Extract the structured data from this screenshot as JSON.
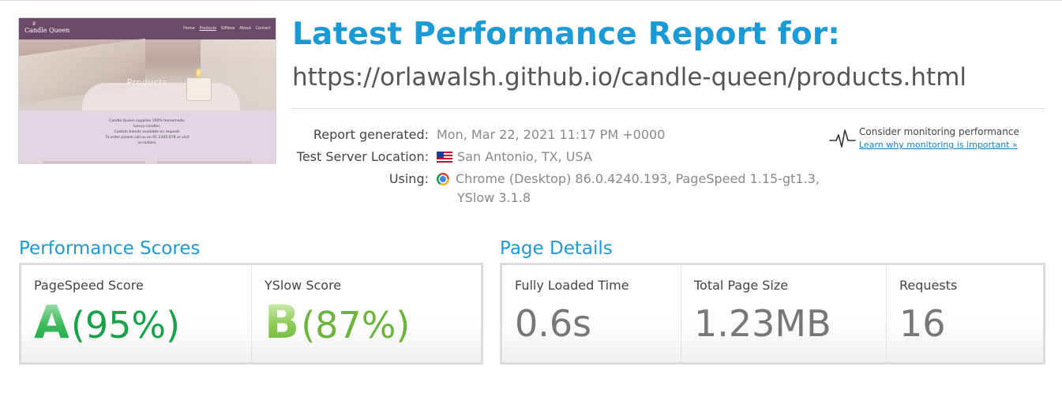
{
  "thumbnail": {
    "brand": "Candle Queen",
    "nav": [
      "Home",
      "Products",
      "Giftbox",
      "About",
      "Contact"
    ],
    "hero_title": "Products",
    "body_lines": [
      "Candle Queen supplies 100% homemade,",
      "luxury candles.",
      "Custom blends available on request.",
      "To order please call us on 01 2345 678 or visit",
      "us instore."
    ]
  },
  "header": {
    "title": "Latest Performance Report for:",
    "url": "https://orlawalsh.github.io/candle-queen/products.html"
  },
  "report": {
    "generated_label": "Report generated:",
    "generated_value": "Mon, Mar 22, 2021 11:17 PM +0000",
    "location_label": "Test Server Location:",
    "location_value": "San Antonio, TX, USA",
    "using_label": "Using:",
    "using_value_line1": "Chrome (Desktop) 86.0.4240.193, PageSpeed 1.15-gt1.3,",
    "using_value_line2": "YSlow 3.1.8"
  },
  "monitoring": {
    "text": "Consider monitoring performance",
    "link": "Learn why monitoring is important »",
    "icon": "heartbeat-icon"
  },
  "performance": {
    "title": "Performance Scores",
    "pagespeed": {
      "label": "PageSpeed Score",
      "grade": "A",
      "percent": "(95%)",
      "color": "#1aa24a"
    },
    "yslow": {
      "label": "YSlow Score",
      "grade": "B",
      "percent": "(87%)",
      "color": "#6db43c"
    }
  },
  "details": {
    "title": "Page Details",
    "loaded": {
      "label": "Fully Loaded Time",
      "value": "0.6s"
    },
    "size": {
      "label": "Total Page Size",
      "value": "1.23MB"
    },
    "requests": {
      "label": "Requests",
      "value": "16"
    }
  },
  "colors": {
    "accent": "#1b9ad6",
    "link": "#1b7fc4"
  }
}
